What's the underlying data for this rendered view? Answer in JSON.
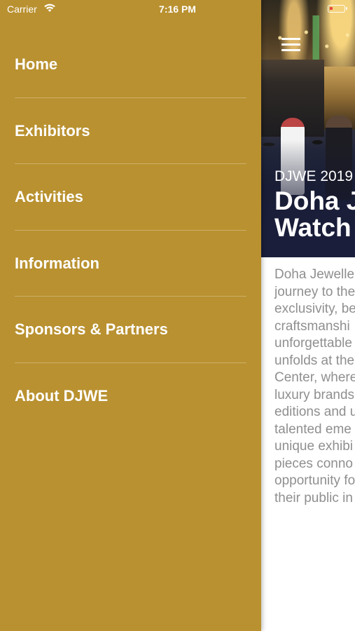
{
  "status_bar": {
    "carrier": "Carrier",
    "time": "7:16 PM",
    "icons": [
      "wifi-icon",
      "battery-icon"
    ]
  },
  "drawer": {
    "background_color": "#b99130",
    "items": [
      {
        "label": "Home"
      },
      {
        "label": "Exhibitors"
      },
      {
        "label": "Activities"
      },
      {
        "label": "Information"
      },
      {
        "label": "Sponsors & Partners"
      },
      {
        "label": "About DJWE"
      }
    ]
  },
  "main": {
    "menu_icon": "hamburger-menu-icon",
    "hero": {
      "subtitle": "DJWE 2019",
      "title_lines": [
        "Doha J",
        "Watch"
      ]
    },
    "intro_lines": [
      "Doha Jewelle",
      "journey to the",
      "exclusivity, be",
      "craftsmanshi",
      "unforgettable",
      "unfolds at the",
      "Center, where",
      "luxury brands",
      "editions and u",
      "talented eme",
      "unique exhibi",
      "pieces conno",
      "opportunity fo",
      "their public in"
    ],
    "intro_text_color": "#8f8f8f"
  }
}
